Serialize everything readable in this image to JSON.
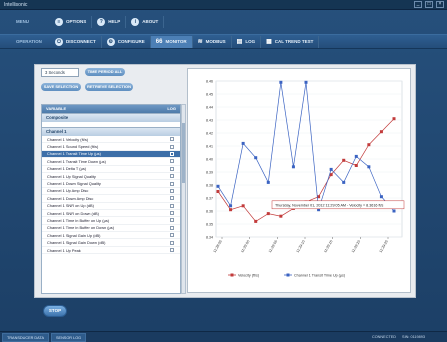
{
  "window": {
    "app_name": "Intellisonic",
    "controls": [
      "_",
      "□",
      "×"
    ]
  },
  "nav1": {
    "label": "MENU",
    "items": [
      {
        "label": "OPTIONS",
        "icon": "options-icon"
      },
      {
        "label": "HELP",
        "icon": "help-icon"
      },
      {
        "label": "ABOUT",
        "icon": "about-icon"
      }
    ]
  },
  "nav2": {
    "label": "OPERATION",
    "items": [
      {
        "label": "DISCONNECT",
        "icon": "disconnect-icon"
      },
      {
        "label": "CONFIGURE",
        "icon": "configure-icon"
      },
      {
        "label": "MONITOR",
        "icon": "monitor-icon"
      },
      {
        "label": "MODBUS",
        "icon": "wireless-icon"
      },
      {
        "label": "LOG",
        "icon": "log-icon"
      },
      {
        "label": "CAL TREND TEST",
        "icon": "calendar-icon"
      }
    ]
  },
  "controls": {
    "interval_select": "3 Seconds",
    "pill_top": "TIME PERIOD ALL",
    "pill_save": "SAVE SELECTION",
    "pill_retrieve": "RETRIEVE SELECTION"
  },
  "variables": {
    "header_variable": "VARIABLE",
    "header_log": "LOG",
    "group_composite": "Composite",
    "group_channel": "Channel 1",
    "rows": [
      "Channel 1 Velocity (ft/s)",
      "Channel 1 Sound Speed (ft/s)",
      "Channel 1 Transit Time Up (µs)",
      "Channel 1 Transit Time Down (µs)",
      "Channel 1 Delta T (µs)",
      "Channel 1 Up Signal Quality",
      "Channel 1 Down Signal Quality",
      "Channel 1 Up Amp Disc",
      "Channel 1 Down Amp Disc",
      "Channel 1 SNR on Up (dB)",
      "Channel 1 SNR on Down (dB)",
      "Channel 1 Time in Buffer on Up (µs)",
      "Channel 1 Time in Buffer on Down (µs)",
      "Channel 1 Signal Gain Up (dB)",
      "Channel 1 Signal Gain Down (dB)",
      "Channel 1 Up Peak"
    ],
    "selected_index": 2
  },
  "tooltip": "Thursday, November 01, 2012 11:29:05 AM - Velocity = 8.3616 ft/s",
  "stop_label": "STOP",
  "status": {
    "tabs": [
      "TRANSDUCER DATA",
      "SENSOR LOG"
    ],
    "connection": "CONNECTED",
    "port": "SIN: 0119893"
  },
  "chart_data": {
    "type": "line",
    "y_ticks": [
      "8.46",
      "8.45",
      "8.44",
      "8.43",
      "8.42",
      "8.41",
      "8.40",
      "8.39",
      "8.38",
      "8.37",
      "8.36",
      "8.35",
      "8.34"
    ],
    "y_range": [
      8.34,
      8.46
    ],
    "x_ticks": [
      "11:28:55",
      "11:29:00",
      "11:29:05",
      "11:29:10",
      "11:29:15",
      "11:29:20",
      "11:29:25"
    ],
    "series": [
      {
        "name": "Velocity (ft/s)",
        "color": "#c23b3b",
        "values": [
          8.375,
          8.361,
          8.364,
          8.352,
          8.358,
          8.356,
          8.362,
          8.367,
          8.371,
          8.388,
          8.399,
          8.395,
          8.411,
          8.421,
          8.431
        ]
      },
      {
        "name": "Channel 1 Transit Time Up (µs)",
        "color": "#3b63c2",
        "values": [
          8.379,
          8.364,
          8.412,
          8.401,
          8.382,
          8.459,
          8.394,
          8.459,
          8.361,
          8.392,
          8.382,
          8.402,
          8.394,
          8.371,
          8.36
        ]
      }
    ]
  }
}
